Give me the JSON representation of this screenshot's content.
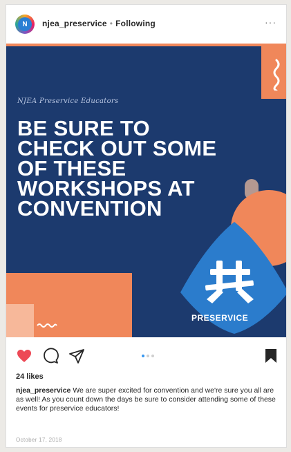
{
  "header": {
    "avatar_letter": "N",
    "username": "njea_preservice",
    "separator": "•",
    "follow_label": "Following",
    "more_label": "···"
  },
  "post": {
    "subhead": "NJEA Preservice Educators",
    "headline": [
      "BE SURE TO",
      "CHECK OUT SOME",
      "OF THESE",
      "WORKSHOPS AT",
      "CONVENTION"
    ],
    "brand_text": "PRESERVICE",
    "colors": {
      "navy": "#1c3a6e",
      "accent": "#f0875a",
      "shield": "#2b7ccc"
    }
  },
  "actions": {
    "like_icon": "heart-icon",
    "comment_icon": "comment-icon",
    "share_icon": "send-icon",
    "save_icon": "bookmark-icon",
    "liked": true,
    "carousel_total": 3,
    "carousel_active": 1
  },
  "likes": "24 likes",
  "caption": {
    "username": "njea_preservice",
    "text": "We are super excited for convention and we're sure you all are as well! As you count down the days be sure to consider attending some of these events for preservice educators!"
  },
  "date": "October 17, 2018"
}
